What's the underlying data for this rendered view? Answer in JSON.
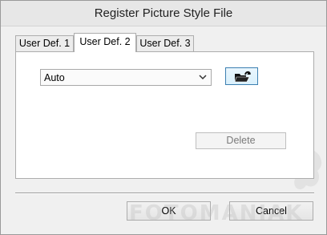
{
  "window": {
    "title": "Register Picture Style File"
  },
  "tabs": [
    {
      "label": "User Def. 1",
      "active": false
    },
    {
      "label": "User Def. 2",
      "active": true
    },
    {
      "label": "User Def. 3",
      "active": false
    }
  ],
  "style_select": {
    "value": "Auto"
  },
  "open_file_button": {
    "icon": "open-folder-icon"
  },
  "delete_button": {
    "label": "Delete",
    "enabled": false
  },
  "footer": {
    "ok_label": "OK",
    "cancel_label": "Cancel"
  },
  "watermark": {
    "text": "FOTOMANIAK"
  },
  "colors": {
    "accent": "#3c7fb1",
    "panel": "#ffffff",
    "window": "#f0f0f0"
  }
}
